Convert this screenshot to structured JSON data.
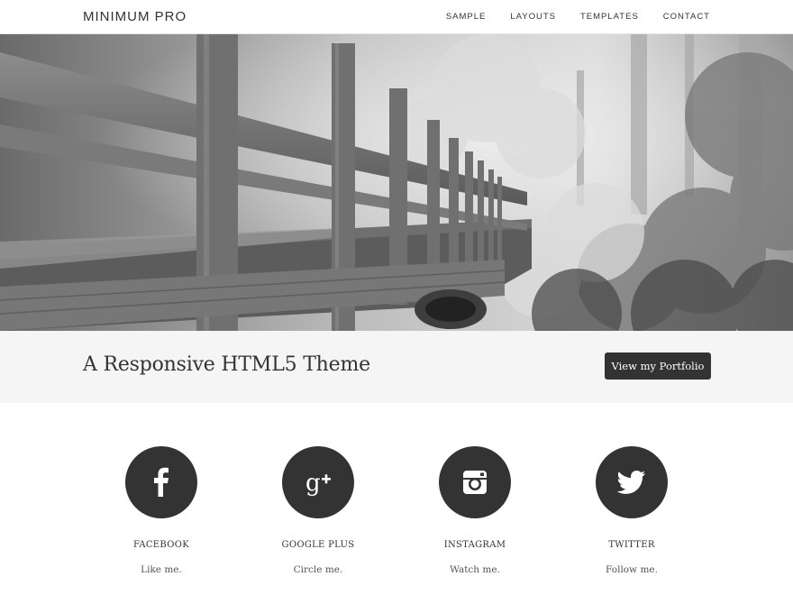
{
  "header": {
    "logo": "MINIMUM PRO",
    "nav": [
      "SAMPLE",
      "LAYOUTS",
      "TEMPLATES",
      "CONTACT"
    ]
  },
  "hero": {
    "image": "black-and-white-wooden-bridge-forest-photo"
  },
  "band": {
    "tagline": "A Responsive HTML5 Theme",
    "button_label": "View my Portfolio"
  },
  "social": [
    {
      "name": "FACEBOOK",
      "caption": "Like me.",
      "icon": "facebook-icon"
    },
    {
      "name": "GOOGLE PLUS",
      "caption": "Circle me.",
      "icon": "google-plus-icon"
    },
    {
      "name": "INSTAGRAM",
      "caption": "Watch me.",
      "icon": "instagram-icon"
    },
    {
      "name": "TWITTER",
      "caption": "Follow me.",
      "icon": "twitter-icon"
    }
  ],
  "colors": {
    "accent": "#333333",
    "band_background": "#f5f5f5"
  }
}
